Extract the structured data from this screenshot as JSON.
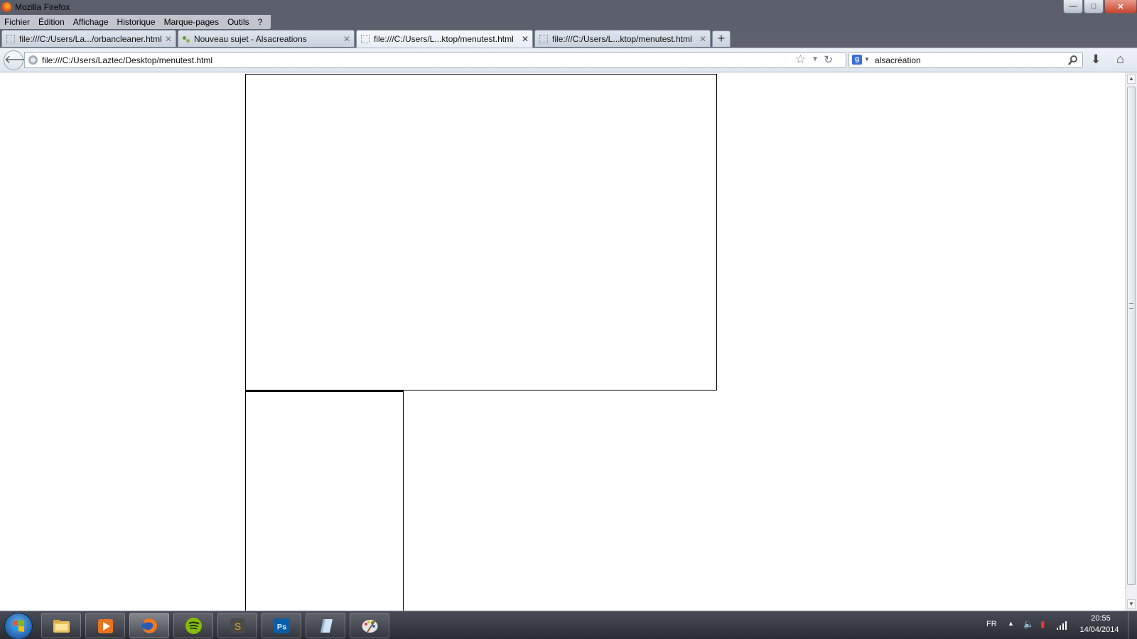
{
  "window": {
    "title": "Mozilla Firefox",
    "controls": {
      "minimize": "—",
      "maximize": "□",
      "close": "✕"
    }
  },
  "menu": {
    "items": [
      {
        "label": "Fichier"
      },
      {
        "label": "Édition"
      },
      {
        "label": "Affichage"
      },
      {
        "label": "Historique"
      },
      {
        "label": "Marque-pages"
      },
      {
        "label": "Outils"
      },
      {
        "label": "?"
      }
    ]
  },
  "tabs": [
    {
      "label": "file:///C:/Users/La.../orbancleaner.html",
      "active": false,
      "icon": "blank-page-icon"
    },
    {
      "label": "Nouveau sujet - Alsacreations",
      "active": false,
      "icon": "alsacreations-icon"
    },
    {
      "label": "file:///C:/Users/L...ktop/menutest.html",
      "active": true,
      "icon": "blank-page-icon"
    },
    {
      "label": "file:///C:/Users/L...ktop/menutest.html",
      "active": false,
      "icon": "blank-page-icon"
    }
  ],
  "new_tab_label": "+",
  "tab_close_glyph": "✕",
  "navbar": {
    "back_glyph": "🡐",
    "url": "file:///C:/Users/Laztec/Desktop/menutest.html",
    "search_engine_glyph": "g",
    "search_query": "alsacréation"
  },
  "taskbar": {
    "apps": [
      {
        "name": "windows-explorer",
        "active": false
      },
      {
        "name": "media-player",
        "active": false
      },
      {
        "name": "firefox",
        "active": true
      },
      {
        "name": "spotify",
        "active": false
      },
      {
        "name": "sublime-text",
        "active": false
      },
      {
        "name": "photoshop",
        "active": false
      },
      {
        "name": "notes-app",
        "active": false
      },
      {
        "name": "paint",
        "active": false
      }
    ],
    "photoshop_label": "Ps",
    "sublime_label": "S",
    "tray": {
      "language": "FR",
      "time": "20:55",
      "date": "14/04/2014"
    }
  },
  "colors": {
    "accent_blue": "#2a6eb8",
    "spotify_green": "#84bd00",
    "photoshop_blue": "#0a5da6"
  }
}
